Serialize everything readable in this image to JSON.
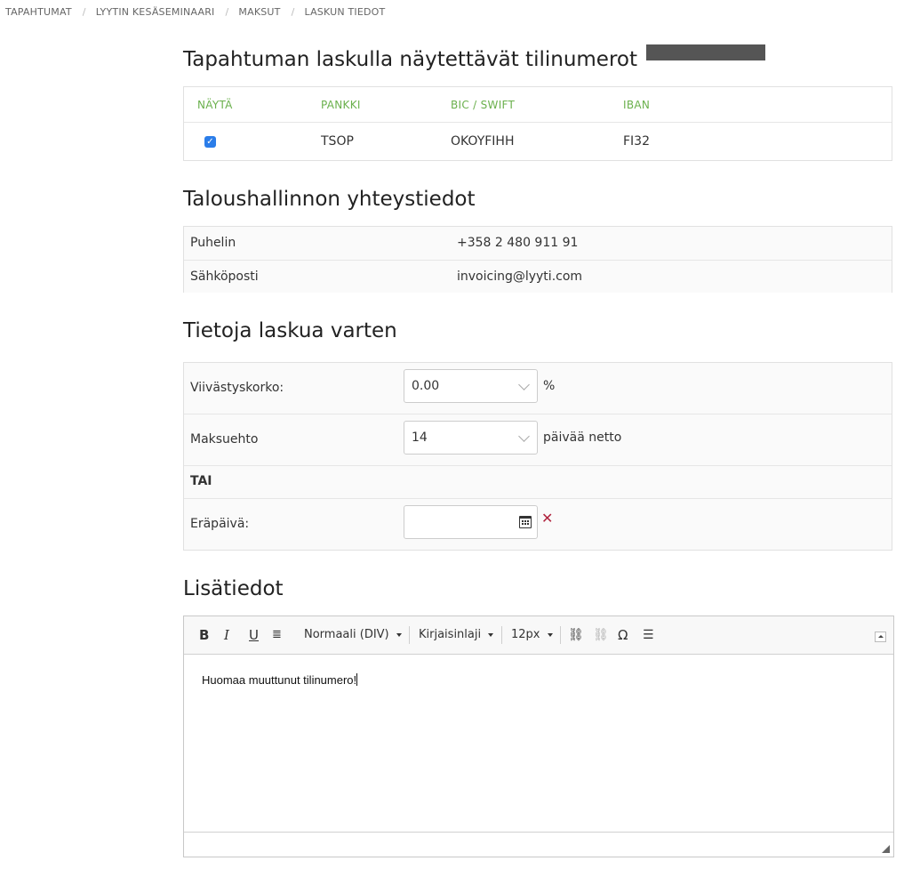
{
  "breadcrumb": [
    "TAPAHTUMAT",
    "LYYTIN KESÄSEMINAARI",
    "MAKSUT",
    "LASKUN TIEDOT"
  ],
  "bank_section": {
    "title": "Tapahtuman laskulla näytettävät tilinumerot",
    "headers": {
      "show": "NÄYTÄ",
      "bank": "PANKKI",
      "bic": "BIC / SWIFT",
      "iban": "IBAN"
    },
    "row": {
      "checked": true,
      "bank": "TSOP",
      "bic": "OKOYFIHH",
      "iban": "FI32"
    }
  },
  "contact_section": {
    "title": "Taloushallinnon yhteystiedot",
    "rows": [
      {
        "label": "Puhelin",
        "value": "+358 2 480 911 91"
      },
      {
        "label": "Sähköposti",
        "value": "invoicing@lyyti.com"
      }
    ]
  },
  "invoice_section": {
    "title": "Tietoja laskua varten",
    "late_interest": {
      "label": "Viivästyskorko:",
      "value": "0.00",
      "suffix": "%"
    },
    "payment_terms": {
      "label": "Maksuehto",
      "value": "14",
      "suffix": "päivää netto"
    },
    "or_label": "TAI",
    "due_date": {
      "label": "Eräpäivä:",
      "value": ""
    }
  },
  "extra_section": {
    "title": "Lisätiedot",
    "toolbar": {
      "bold": "B",
      "italic": "I",
      "underline": "U",
      "format": "Normaali (DIV)",
      "font": "Kirjaisinlaji",
      "size": "12px",
      "omega": "Ω"
    },
    "content": "Huomaa muuttunut tilinumero!"
  }
}
